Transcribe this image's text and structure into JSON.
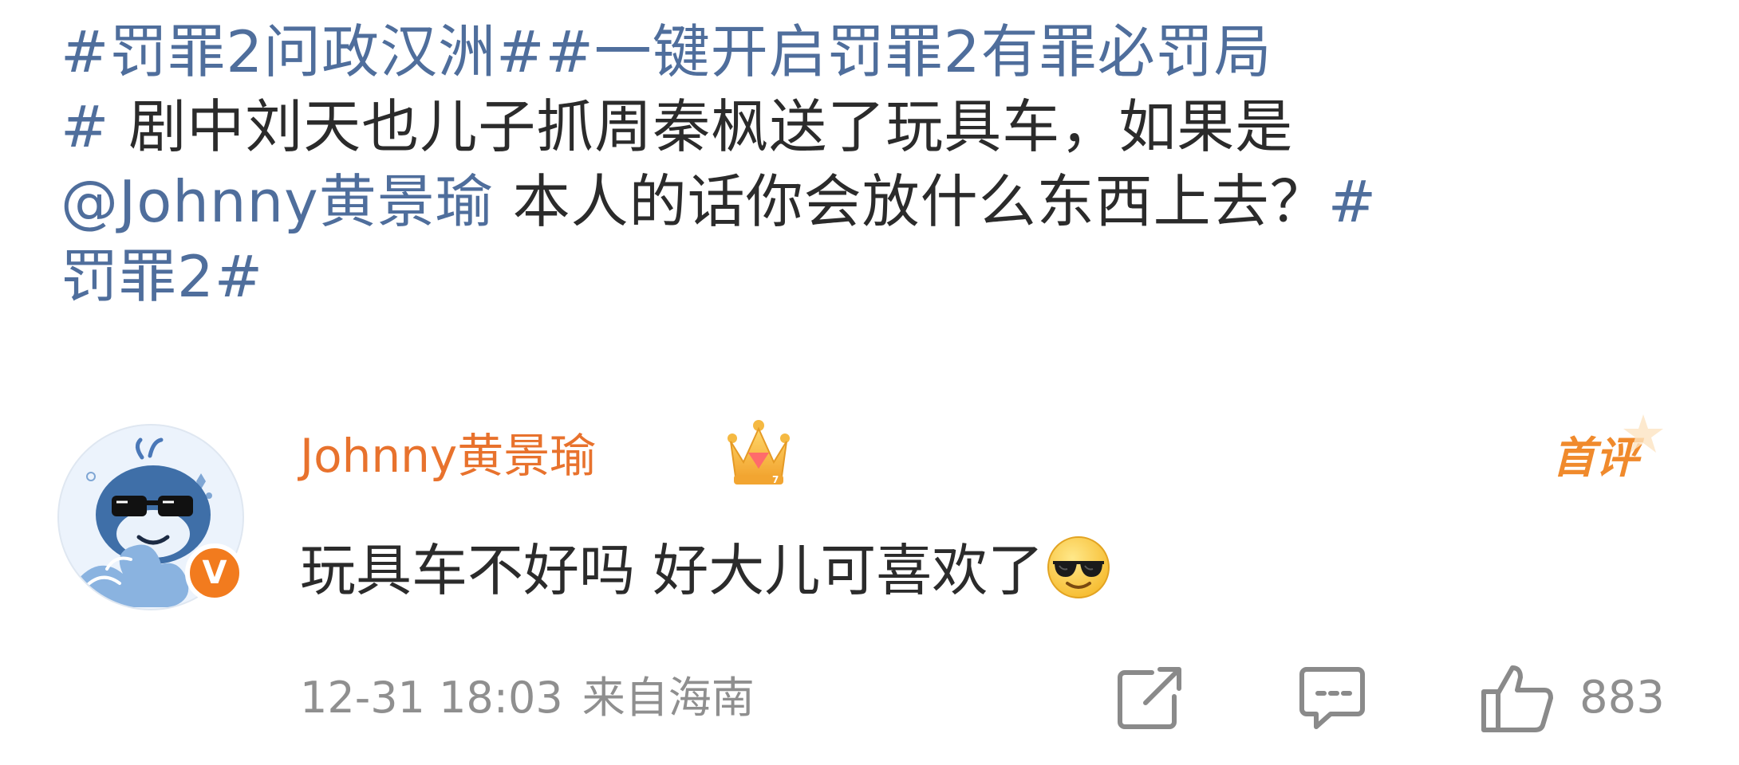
{
  "post": {
    "line1": [
      {
        "text": "#罚罪2问政汉洲##一键开启罚罪2有罪必罚局",
        "kind": "link"
      }
    ],
    "line2": [
      {
        "text": "#",
        "kind": "link"
      },
      {
        "text": " 剧中刘天也儿子抓周秦枫送了玩具车，如果是",
        "kind": "text"
      }
    ],
    "line3": [
      {
        "text": "@Johnny黄景瑜",
        "kind": "link"
      },
      {
        "text": " 本人的话你会放什么东西上去？",
        "kind": "text"
      },
      {
        "text": "#",
        "kind": "link"
      }
    ],
    "line4": [
      {
        "text": "罚罪2#",
        "kind": "link"
      }
    ]
  },
  "comment": {
    "author": "Johnny黄景瑜",
    "verified_mark": "V",
    "badge_icon": "crown-icon",
    "tag": "首评",
    "text": "玩具车不好吗 好大儿可喜欢了",
    "emoji": "sunglasses-emoji",
    "timestamp": "12-31 18:03",
    "location": "来自海南",
    "likes": "883"
  },
  "colors": {
    "link": "#4f6e9c",
    "author": "#e8722d",
    "tag": "#f08a2c",
    "meta": "#8f8f8f",
    "verified": "#f27b1e"
  }
}
